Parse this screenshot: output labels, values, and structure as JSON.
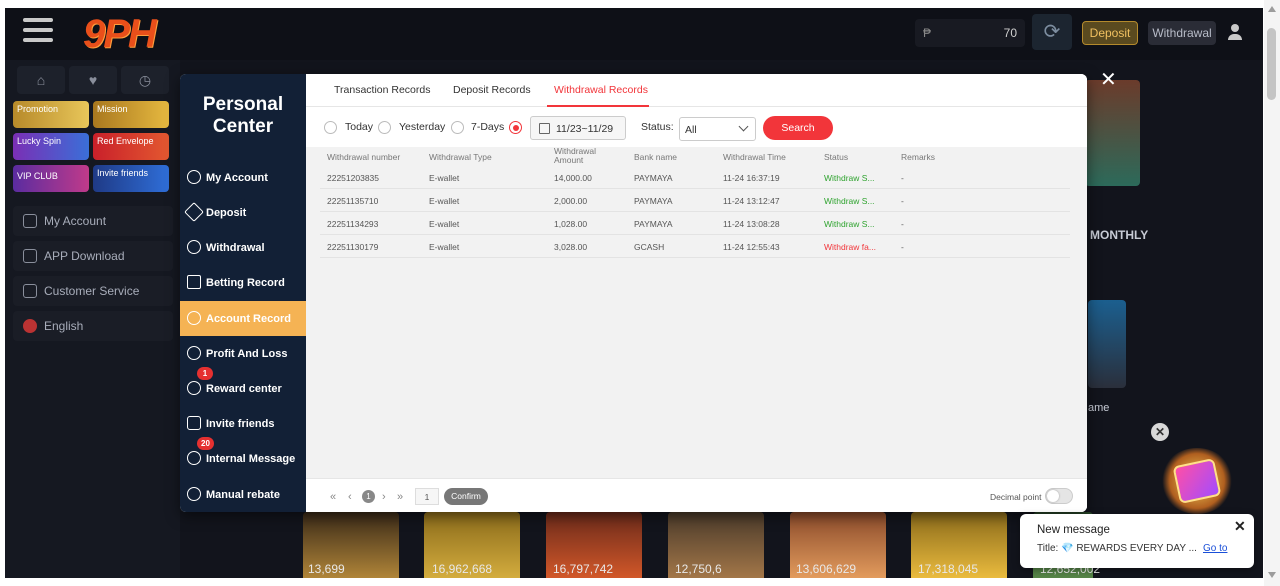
{
  "app": {
    "logo_text": "9PH",
    "currency_symbol": "₱",
    "balance": "70",
    "deposit_label": "Deposit",
    "withdrawal_label": "Withdrawal"
  },
  "left_sidebar": {
    "promo_tiles": [
      {
        "label": "Promotion"
      },
      {
        "label": "Mission"
      },
      {
        "label": "Lucky Spin"
      },
      {
        "label": "Red Envelope"
      },
      {
        "label": "VIP CLUB"
      },
      {
        "label": "Invite friends"
      }
    ],
    "menu": [
      {
        "label": "My Account"
      },
      {
        "label": "APP Download"
      },
      {
        "label": "Customer Service"
      },
      {
        "label": "English"
      }
    ]
  },
  "background": {
    "monthly_text": "MONTHLY",
    "game_name_fragment": "ame",
    "game_counts": [
      "13,699",
      "16,962,668",
      "16,797,742",
      "12,750,6",
      "13,606,629",
      "17,318,045",
      "12,652,002"
    ]
  },
  "personal_center": {
    "title_line1": "Personal",
    "title_line2": "Center",
    "items": [
      {
        "label": "My Account"
      },
      {
        "label": "Deposit"
      },
      {
        "label": "Withdrawal"
      },
      {
        "label": "Betting Record"
      },
      {
        "label": "Account Record"
      },
      {
        "label": "Profit And Loss"
      },
      {
        "label": "Reward center",
        "badge": "1"
      },
      {
        "label": "Invite friends"
      },
      {
        "label": "Internal Message",
        "badge": "20"
      },
      {
        "label": "Manual rebate"
      }
    ]
  },
  "tabs": [
    {
      "label": "Transaction Records"
    },
    {
      "label": "Deposit Records"
    },
    {
      "label": "Withdrawal Records"
    }
  ],
  "filters": {
    "options": [
      "Today",
      "Yesterday",
      "7-Days"
    ],
    "date_range": "11/23~11/29",
    "status_label": "Status:",
    "status_value": "All",
    "search_label": "Search"
  },
  "table": {
    "headers": [
      "Withdrawal number",
      "Withdrawal Type",
      "Withdrawal Amount",
      "Bank name",
      "Withdrawal Time",
      "Status",
      "Remarks"
    ],
    "rows": [
      [
        "22251203835",
        "E-wallet",
        "14,000.00",
        "PAYMAYA",
        "11-24 16:37:19",
        "Withdraw S...",
        "-"
      ],
      [
        "22251135710",
        "E-wallet",
        "2,000.00",
        "PAYMAYA",
        "11-24 13:12:47",
        "Withdraw S...",
        "-"
      ],
      [
        "22251134293",
        "E-wallet",
        "1,028.00",
        "PAYMAYA",
        "11-24 13:08:28",
        "Withdraw S...",
        "-"
      ],
      [
        "22251130179",
        "E-wallet",
        "3,028.00",
        "GCASH",
        "11-24 12:55:43",
        "Withdraw fa...",
        "-"
      ]
    ]
  },
  "pager": {
    "current_page": "1",
    "page_input": "1",
    "confirm_label": "Confirm",
    "decimal_point_label": "Decimal point"
  },
  "notification": {
    "title": "New message",
    "message_prefix": "Title:",
    "message_text": "REWARDS EVERY DAY ...",
    "goto_label": "Go to"
  },
  "colors": {
    "accent_red": "#f2353a",
    "active_menu": "#f5b354",
    "sidebar_bg": "#122036",
    "success_green": "#2fa32f"
  }
}
